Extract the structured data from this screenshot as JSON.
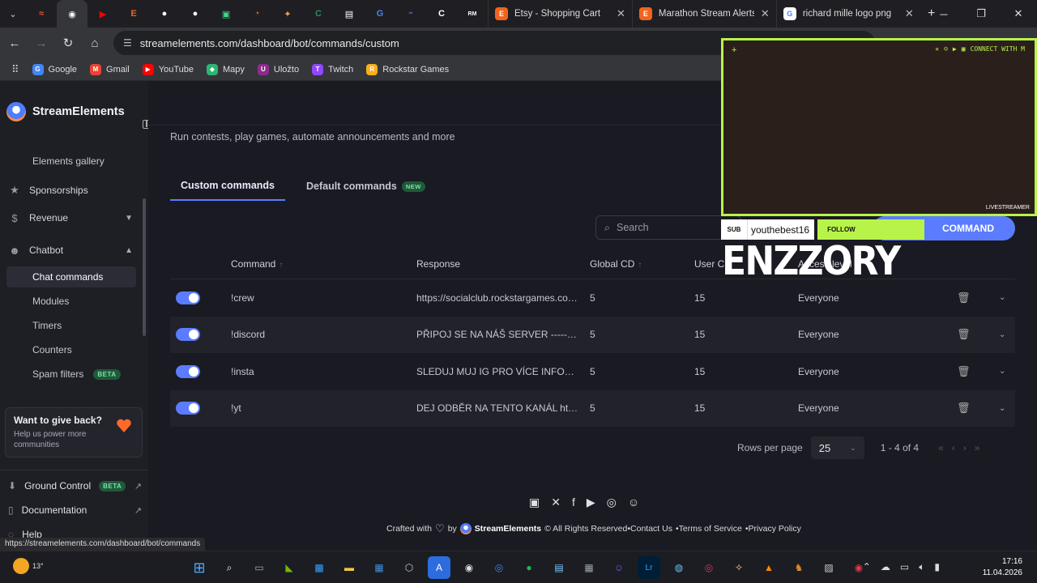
{
  "browser": {
    "tabs": [
      {
        "title": "Etsy - Shopping Cart",
        "favicon_color": "#f1641e",
        "letter": "E"
      },
      {
        "title": "Marathon Stream Alerts",
        "favicon_color": "#f1641e",
        "letter": "E"
      },
      {
        "title": "richard mille logo png",
        "favicon_color": "#4285f4",
        "letter": "G"
      }
    ],
    "pinned": [
      {
        "name": "seo-tab",
        "color": "#e8532a",
        "glyph": "≈"
      },
      {
        "name": "streamelements-tab",
        "color": "#ffffff",
        "glyph": "◉"
      },
      {
        "name": "youtube-tab",
        "color": "#ff0000",
        "glyph": "▶"
      },
      {
        "name": "etsy-tab",
        "color": "#f1641e",
        "glyph": "E"
      },
      {
        "name": "tab-5",
        "color": "#ffffff",
        "glyph": "●"
      },
      {
        "name": "tab-6",
        "color": "#ffffff",
        "glyph": "●"
      },
      {
        "name": "tab-7",
        "color": "#3ddc84",
        "glyph": "▣"
      },
      {
        "name": "tab-8",
        "color": "#ff6b1a",
        "glyph": "◔"
      },
      {
        "name": "tab-9",
        "color": "#f2a03d",
        "glyph": "✦"
      },
      {
        "name": "tab-10",
        "color": "#2d8a5a",
        "glyph": "C"
      },
      {
        "name": "tab-11",
        "color": "#ffffff",
        "glyph": "▤"
      },
      {
        "name": "google-tab",
        "color": "#4285f4",
        "glyph": "G"
      },
      {
        "name": "tab-13",
        "color": "#3a5ba0",
        "glyph": "◓"
      },
      {
        "name": "tab-14",
        "color": "#ffffff",
        "glyph": "C"
      },
      {
        "name": "tab-15",
        "color": "#ffffff",
        "glyph": "RM"
      }
    ],
    "url": "streamelements.com/dashboard/bot/commands/custom",
    "bookmarks": [
      {
        "label": "Google",
        "color": "#4285f4",
        "letter": "G"
      },
      {
        "label": "Gmail",
        "color": "#ea4335",
        "letter": "M"
      },
      {
        "label": "YouTube",
        "color": "#ff0000",
        "letter": "▶"
      },
      {
        "label": "Mapy",
        "color": "#2bb673",
        "letter": "◆"
      },
      {
        "label": "Uložto",
        "color": "#8e2a8e",
        "letter": "U"
      },
      {
        "label": "Twitch",
        "color": "#9146ff",
        "letter": "T"
      },
      {
        "label": "Rockstar Games",
        "color": "#fcaf17",
        "letter": "R"
      }
    ],
    "status_url": "https://streamelements.com/dashboard/bot/commands"
  },
  "sidebar": {
    "brand": "StreamElements",
    "elements_gallery": "Elements gallery",
    "sponsorships": "Sponsorships",
    "revenue": "Revenue",
    "chatbot": "Chatbot",
    "sub_items": [
      "Chat commands",
      "Modules",
      "Timers",
      "Counters",
      "Spam filters"
    ],
    "beta": "BETA",
    "giveback_title": "Want to give back?",
    "giveback_sub": "Help us power more communities",
    "ground_control": "Ground Control",
    "documentation": "Documentation",
    "help": "Help"
  },
  "main": {
    "subtitle": "Run contests, play games, automate announcements and more",
    "tab_custom": "Custom commands",
    "tab_default": "Default commands",
    "new_badge": "NEW",
    "search_placeholder": "Search",
    "add_button": "COMMAND",
    "headers": {
      "command": "Command",
      "response": "Response",
      "global_cd": "Global CD",
      "user_cd": "User C",
      "access": "Access level"
    },
    "rows": [
      {
        "command": "!crew",
        "response": "https://socialclub.rockstargames.com...",
        "global_cd": "5",
        "user_cd": "15",
        "access": "Everyone"
      },
      {
        "command": "!discord",
        "response": "PŘIPOJ SE NA NÁŠ SERVER --------...",
        "global_cd": "5",
        "user_cd": "15",
        "access": "Everyone"
      },
      {
        "command": "!insta",
        "response": "SLEDUJ MUJ IG PRO VÍCE INFORMÁ...",
        "global_cd": "5",
        "user_cd": "15",
        "access": "Everyone"
      },
      {
        "command": "!yt",
        "response": "DEJ ODBĚR NA TENTO KANÁL http...",
        "global_cd": "5",
        "user_cd": "15",
        "access": "Everyone"
      }
    ],
    "rows_per_page_label": "Rows per page",
    "rows_per_page": "25",
    "range": "1 - 4 of 4",
    "footer": {
      "crafted": "Crafted with",
      "by": "by",
      "brand": "StreamElements",
      "rights": "© All Rights Reserved•Contact Us",
      "terms": "•Terms of Service",
      "privacy": "•Privacy Policy"
    }
  },
  "overlay": {
    "connect": "CONNECT WITH M",
    "livestreamer": "LIVESTREAMER",
    "sub_label": "SUB",
    "sub_name": "youthebest16",
    "follow_label": "FOLLOW",
    "streamer": "ENZZORY",
    "accent": "#b8f34a"
  },
  "taskbar": {
    "temp": "13°",
    "time": "17:16",
    "date": "11.04.2026"
  },
  "colors": {
    "accent": "#5b7cff",
    "beta_bg": "#1f5a3a",
    "beta_fg": "#7ee0a4"
  }
}
